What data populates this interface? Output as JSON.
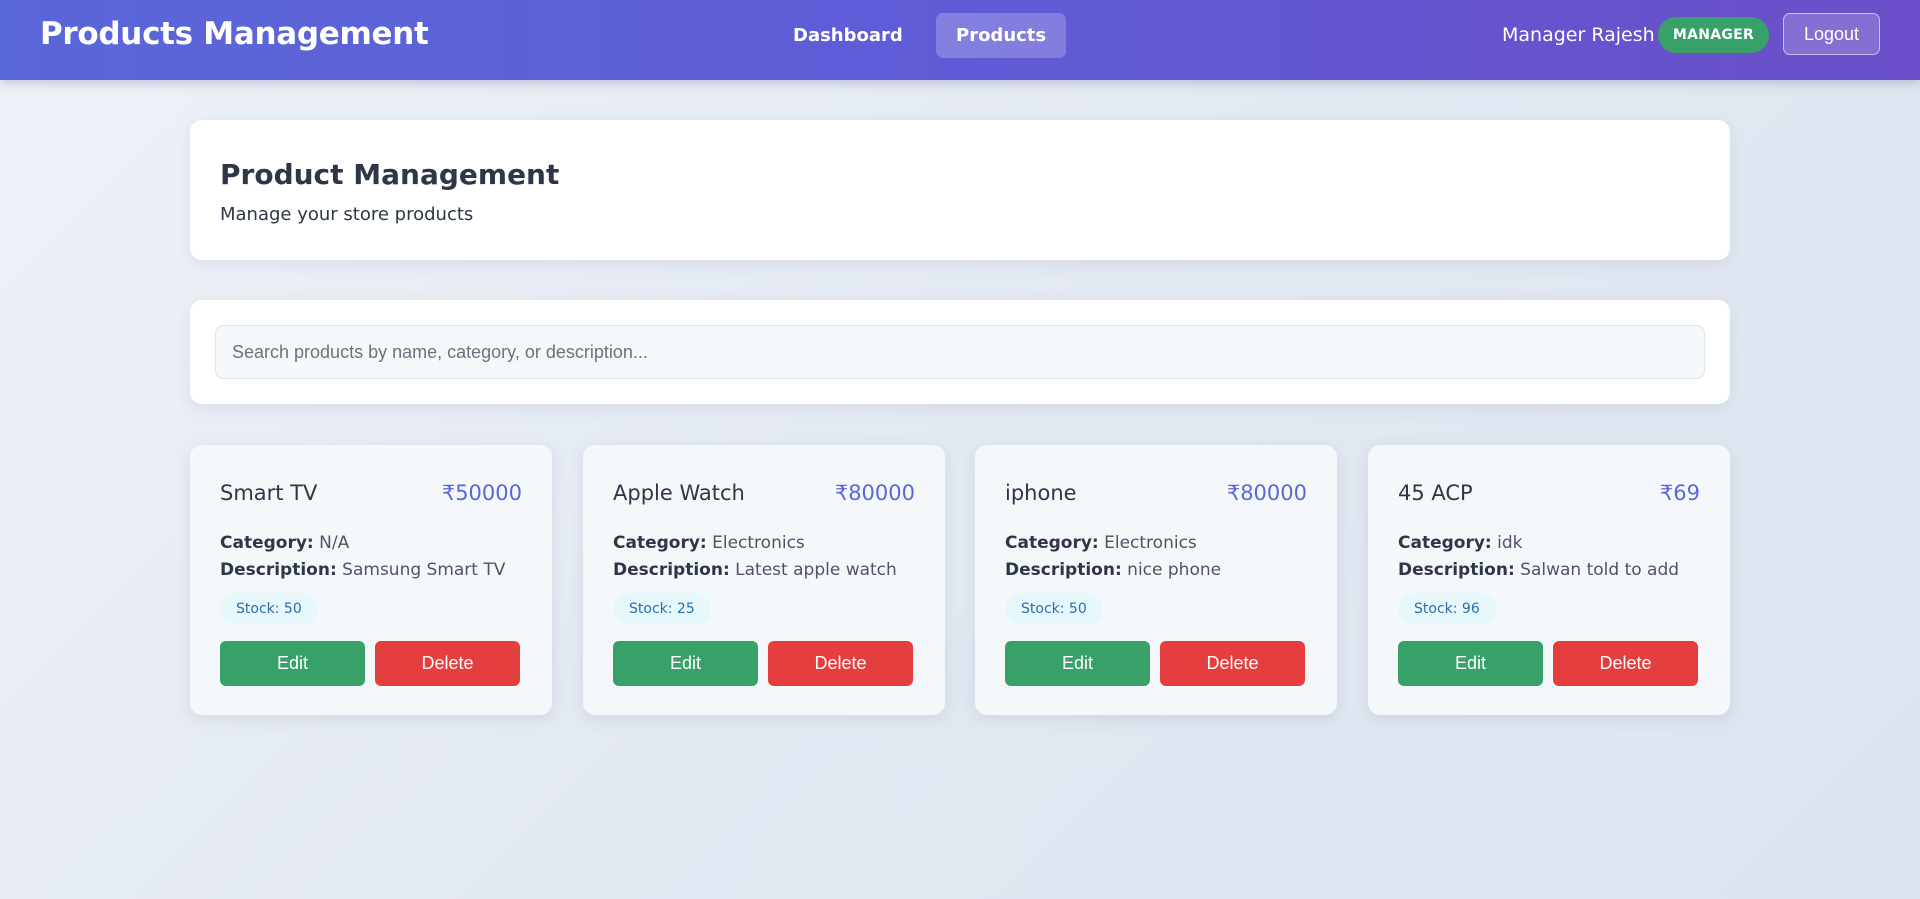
{
  "navbar": {
    "brand": "Products Management",
    "links": [
      {
        "label": "Dashboard",
        "active": false
      },
      {
        "label": "Products",
        "active": true
      }
    ],
    "user_name": "Manager Rajesh",
    "role_badge": "MANAGER",
    "logout_label": "Logout"
  },
  "header": {
    "title": "Product Management",
    "subtitle": "Manage your store products"
  },
  "search": {
    "placeholder": "Search products by name, category, or description...",
    "value": ""
  },
  "labels": {
    "category": "Category:",
    "description": "Description:",
    "edit": "Edit",
    "delete": "Delete"
  },
  "products": [
    {
      "name": "Smart TV",
      "price": "₹50000",
      "category": "N/A",
      "description": "Samsung Smart TV",
      "stock": "Stock: 50"
    },
    {
      "name": "Apple Watch",
      "price": "₹80000",
      "category": "Electronics",
      "description": "Latest apple watch",
      "stock": "Stock: 25"
    },
    {
      "name": "iphone",
      "price": "₹80000",
      "category": "Electronics",
      "description": "nice phone",
      "stock": "Stock: 50"
    },
    {
      "name": "45 ACP",
      "price": "₹69",
      "category": "idk",
      "description": "Salwan told to add",
      "stock": "Stock: 96"
    }
  ],
  "colors": {
    "nav_start": "#5a67d8",
    "nav_end": "#6b4fc8",
    "price": "#5a67d8",
    "edit": "#38a169",
    "delete": "#e53e3e",
    "badge": "#38a169"
  }
}
